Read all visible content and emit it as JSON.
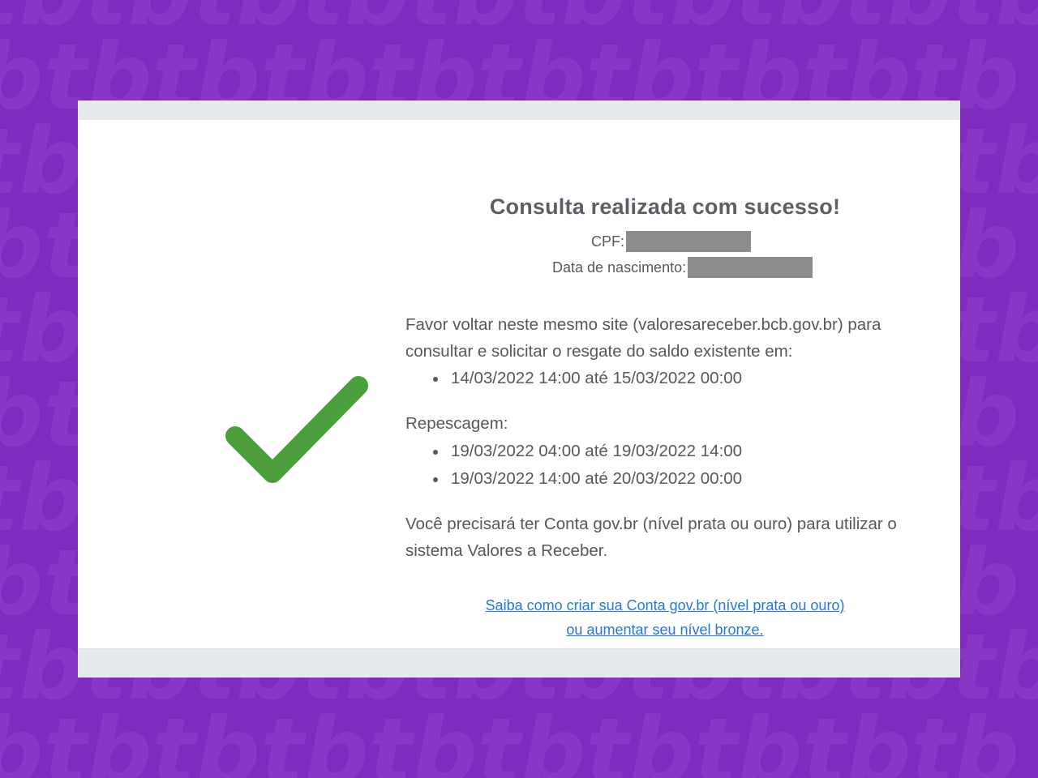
{
  "page": {
    "background_color": "#7e2cbd",
    "pattern_text": "tbtbtbtbtbtbtbtbtbtb"
  },
  "result": {
    "icon": "check-icon",
    "icon_color": "#4a9e3c",
    "title": "Consulta realizada com sucesso!",
    "cpf_label": "CPF:",
    "birth_label": "Data de nascimento:",
    "paragraph1": "Favor voltar neste mesmo site (valoresareceber.bcb.gov.br) para consultar e solicitar o resgate do saldo existente em:",
    "period1": [
      "14/03/2022 14:00 até 15/03/2022 00:00"
    ],
    "paragraph2": "Repescagem:",
    "period2": [
      "19/03/2022 04:00 até 19/03/2022 14:00",
      "19/03/2022 14:00 até 20/03/2022 00:00"
    ],
    "paragraph3": "Você precisará ter Conta gov.br (nível prata ou ouro) para utilizar o sistema Valores a Receber.",
    "link_line1": "Saiba como criar sua Conta gov.br (nível prata ou ouro)",
    "link_line2": "ou aumentar seu nível bronze.",
    "link_color": "#1f77e6"
  }
}
